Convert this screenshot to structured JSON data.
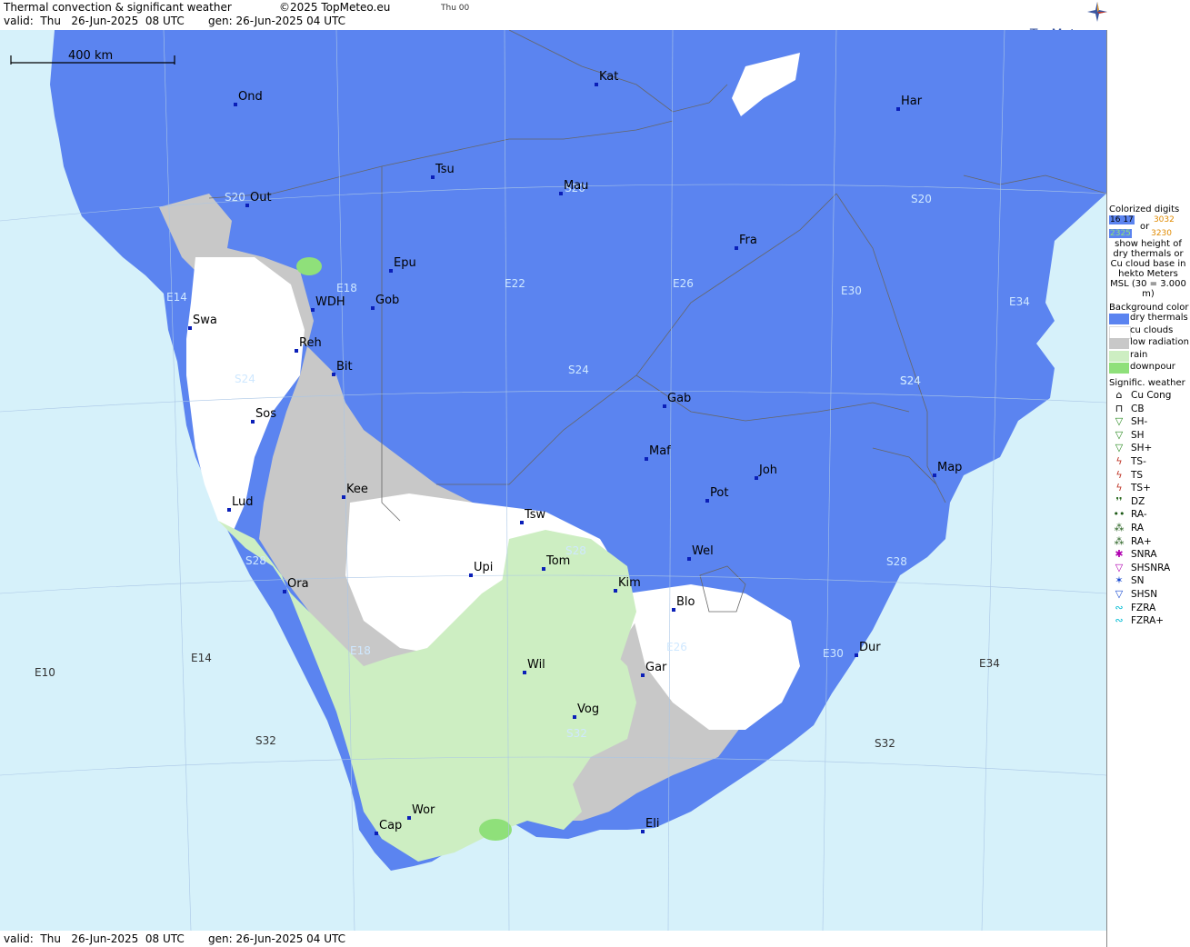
{
  "header": {
    "title": "Thermal convection & significant weather",
    "copyright": "©2025 TopMeteo.eu",
    "day_tag": "Thu 00",
    "valid": "valid:  Thu   26-Jun-2025  08 UTC",
    "gen": "gen: 26-Jun-2025 04 UTC",
    "brand": "TopMeteo"
  },
  "footer": {
    "valid": "valid:  Thu   26-Jun-2025  08 UTC",
    "gen": "gen: 26-Jun-2025 04 UTC"
  },
  "scale_bar": {
    "label": "400 km"
  },
  "cities": [
    "Ond",
    "Kat",
    "Har",
    "Tsu",
    "Mau",
    "Out",
    "Fra",
    "Epu",
    "WDH",
    "Gob",
    "Swa",
    "Reh",
    "Bit",
    "Gab",
    "Sos",
    "Maf",
    "Joh",
    "Map",
    "Kee",
    "Pot",
    "Lud",
    "Tsw",
    "Upi",
    "Tom",
    "Wel",
    "Kim",
    "Blo",
    "Ora",
    "Wil",
    "Gar",
    "Dur",
    "Vog",
    "Wor",
    "Cap",
    "Eli"
  ],
  "grid_labels": [
    "S20",
    "S20",
    "S20",
    "E14",
    "E18",
    "E22",
    "E26",
    "E30",
    "E34",
    "S24",
    "S24",
    "S24",
    "S24",
    "S28",
    "S28",
    "S28",
    "E14",
    "E10",
    "E18",
    "E26",
    "E30",
    "E34",
    "S32",
    "S32",
    "S32"
  ],
  "legend": {
    "colorized_title": "Colorized digits",
    "digits_sample_1": "16 17",
    "digits_sample_2": "3032",
    "or_text": "or",
    "digits_sample_3": "2325",
    "digits_sample_4": "3230",
    "description": "show height of dry thermals or Cu cloud base in hekto Meters MSL (30 = 3.000 m)",
    "bg_title": "Background color",
    "bg_items": [
      {
        "label": "dry thermals",
        "color": "#5b84f0"
      },
      {
        "label": "cu clouds",
        "color": "#ffffff"
      },
      {
        "label": "low radiation",
        "color": "#c8c8c8"
      },
      {
        "label": "rain",
        "color": "#cdeec2"
      },
      {
        "label": "downpour",
        "color": "#8fe07a"
      }
    ],
    "wx_title": "Signific. weather",
    "wx_items": [
      {
        "label": "Cu Cong",
        "icon": "cu-cong-icon"
      },
      {
        "label": "CB",
        "icon": "cb-icon"
      },
      {
        "label": "SH-",
        "icon": "shower-light-icon"
      },
      {
        "label": "SH",
        "icon": "shower-icon"
      },
      {
        "label": "SH+",
        "icon": "shower-heavy-icon"
      },
      {
        "label": "TS-",
        "icon": "thunderstorm-light-icon"
      },
      {
        "label": "TS",
        "icon": "thunderstorm-icon"
      },
      {
        "label": "TS+",
        "icon": "thunderstorm-heavy-icon"
      },
      {
        "label": "DZ",
        "icon": "drizzle-icon"
      },
      {
        "label": "RA-",
        "icon": "rain-light-icon"
      },
      {
        "label": "RA",
        "icon": "rain-icon"
      },
      {
        "label": "RA+",
        "icon": "rain-heavy-icon"
      },
      {
        "label": "SNRA",
        "icon": "snow-rain-icon"
      },
      {
        "label": "SHSNRA",
        "icon": "snow-rain-shower-icon"
      },
      {
        "label": "SN",
        "icon": "snow-icon"
      },
      {
        "label": "SHSN",
        "icon": "snow-shower-icon"
      },
      {
        "label": "FZRA",
        "icon": "freezing-rain-icon"
      },
      {
        "label": "FZRA+",
        "icon": "freezing-rain-heavy-icon"
      }
    ]
  },
  "colors": {
    "sea": "#d6f1fa",
    "dry_thermals": "#5b84f0",
    "cu_clouds": "#ffffff",
    "low_radiation": "#c8c8c8",
    "rain": "#cdeec2",
    "downpour": "#8fe07a",
    "city_marker": "#0b1fb8"
  }
}
